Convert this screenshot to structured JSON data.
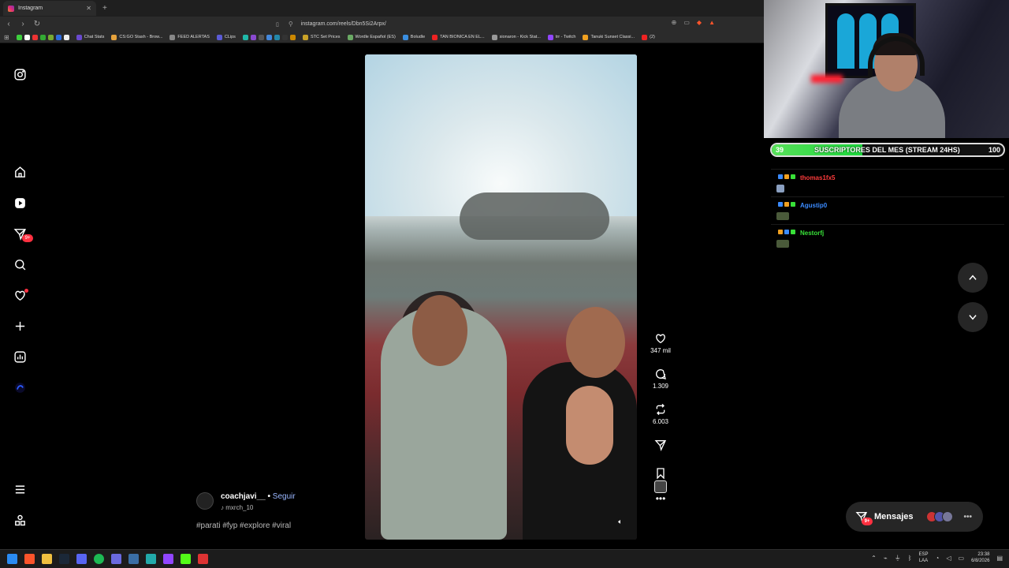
{
  "browser": {
    "tab_title": "Instagram",
    "url": "instagram.com/reels/Dbn5Si2Arpx/",
    "bookmarks": [
      "Chat Stats",
      "CS:GO Stash - Brow...",
      "FEED ALERTAS",
      "CLips",
      "STC Set Prices",
      "Wordle Español (ES)",
      "Boludle",
      "TAN BIONICA EN EL...",
      "sionaron - Kick Stat...",
      "trr - Twitch",
      "Tanuki Sunset Classi...",
      "(2)"
    ]
  },
  "sidebar": {
    "notifications_badge": "9+"
  },
  "reel": {
    "likes": "347 mil",
    "comments": "1.309",
    "reposts": "6.003",
    "username": "coachjavi__",
    "follow_label": "Seguir",
    "separator": "•",
    "audio_user": "mxrch_10",
    "hashtags": "#parati #fyp #explore #viral"
  },
  "messages": {
    "label": "Mensajes",
    "badge": "9+"
  },
  "stream": {
    "sub_current": "39",
    "sub_title": "SUSCRIPTORES DEL MES (STREAM 24HS)",
    "sub_goal": "100",
    "sub_progress": 0.39,
    "chat": [
      {
        "name": "thomas1fx5",
        "color": "#ff3b3b"
      },
      {
        "name": "Agustip0",
        "color": "#3b8bff"
      },
      {
        "name": "Nestorfj",
        "color": "#38e038"
      }
    ]
  },
  "taskbar": {
    "lang1": "ESP",
    "lang2": "LAA",
    "time": "23:38",
    "date": "6/8/2026"
  },
  "colors": {
    "accent_follow": "#9ab7ff",
    "notification": "#ff3040",
    "sub_bar": "#1bd83b"
  }
}
